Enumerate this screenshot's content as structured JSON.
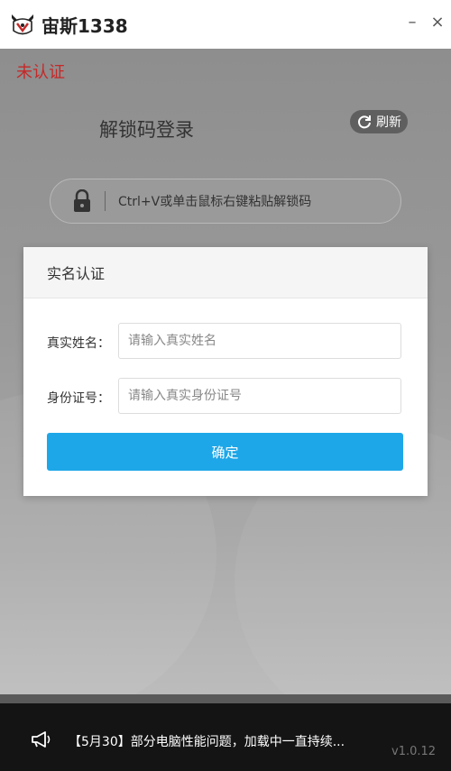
{
  "app": {
    "title": "宙斯1338"
  },
  "window": {
    "minimize": "–",
    "close": "×"
  },
  "main": {
    "status": "未认证",
    "unlock_title": "解锁码登录",
    "refresh_label": "刷新",
    "code_placeholder": "Ctrl+V或单击鼠标右键粘贴解锁码"
  },
  "dialog": {
    "title": "实名认证",
    "name_label": "真实姓名：",
    "name_placeholder": "请输入真实姓名",
    "id_label": "身份证号：",
    "id_placeholder": "请输入真实身份证号",
    "confirm_label": "确定"
  },
  "footer": {
    "notice": "【5月30】部分电脑性能问题，加载中一直持续...",
    "version": "v1.0.12"
  },
  "colors": {
    "accent": "#1ea7e8",
    "status_red": "#c62828"
  }
}
